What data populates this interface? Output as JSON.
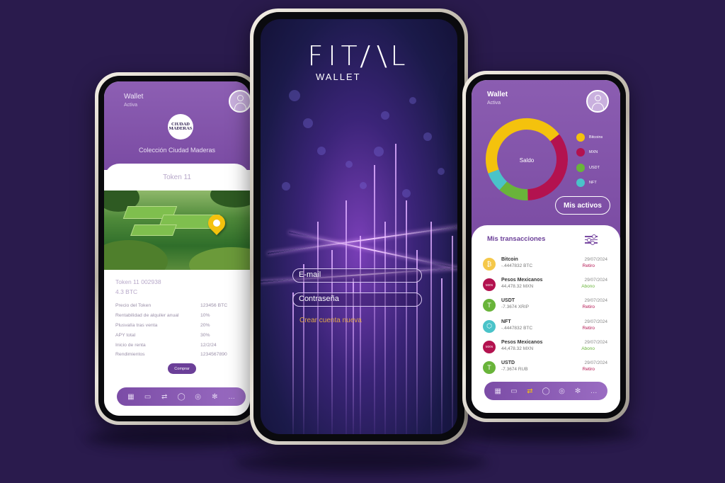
{
  "left_phone": {
    "wallet_label": "Wallet",
    "status": "Activa",
    "logo_lines": [
      "CIUDAD",
      "MADERAS"
    ],
    "collection": "Colección Ciudad Maderas",
    "token_title": "Token 11",
    "token_id": "Token 11 002938",
    "token_price": "4.3 BTC",
    "details": [
      {
        "label": "Precio del Token",
        "value": "123456 BTC"
      },
      {
        "label": "Rentabilidad de alquiler anual",
        "value": "10%"
      },
      {
        "label": "Plusvalía tras venta",
        "value": "20%"
      },
      {
        "label": "APY total",
        "value": "30%"
      },
      {
        "label": "Inicio de renta",
        "value": "12/2/24"
      },
      {
        "label": "Rendimientos",
        "value": "1234567890"
      }
    ],
    "buy_label": "Comprar"
  },
  "center_phone": {
    "brand": "FIT∕\\L",
    "subtitle": "WALLET",
    "email_placeholder": "E-mail",
    "password_placeholder": "Contraseña",
    "create_account": "Crear cuenta nueva"
  },
  "right_phone": {
    "wallet_label": "Wallet",
    "status": "Activa",
    "donut_center": "Saldo",
    "legend": [
      {
        "name": "Bitcoins",
        "color": "#f4c20d"
      },
      {
        "name": "MXN",
        "color": "#b3124f"
      },
      {
        "name": "USDT",
        "color": "#69b43a"
      },
      {
        "name": "NFT",
        "color": "#4ac3c9"
      }
    ],
    "assets_button": "Mis activos",
    "transactions_title": "Mis transacciones",
    "transactions": [
      {
        "name": "Bitcoin",
        "amount": "-.4447832 BTC",
        "date": "29/07/2024",
        "type": "Retiro",
        "icon": "bitcoin-icon",
        "color": "#f5c84a",
        "glyph": "₿"
      },
      {
        "name": "Pesos Mexicanos",
        "amount": "44,478.32 MXN",
        "date": "29/07/2024",
        "type": "Abono",
        "icon": "mxn-icon",
        "color": "#b3124f",
        "glyph": "MXN"
      },
      {
        "name": "USDT",
        "amount": "-7.3674 XRIP",
        "date": "29/07/2024",
        "type": "Retiro",
        "icon": "usdt-icon",
        "color": "#69b43a",
        "glyph": "T"
      },
      {
        "name": "NFT",
        "amount": "-.4447832 BTC",
        "date": "29/07/2024",
        "type": "Retiro",
        "icon": "nft-icon",
        "color": "#4ac3c9",
        "glyph": "⬡"
      },
      {
        "name": "Pesos Mexicanos",
        "amount": "44,478.32 MXN",
        "date": "29/07/2024",
        "type": "Abono",
        "icon": "mxn-icon",
        "color": "#b3124f",
        "glyph": "MXN"
      },
      {
        "name": "USTD",
        "amount": "-7.3674 RUB",
        "date": "29/07/2024",
        "type": "Retiro",
        "icon": "usdt-icon",
        "color": "#69b43a",
        "glyph": "T"
      }
    ],
    "donut_segments": [
      {
        "name": "Bitcoins",
        "value": 45,
        "color": "#f4c20d"
      },
      {
        "name": "MXN",
        "value": 35,
        "color": "#b3124f"
      },
      {
        "name": "USDT",
        "value": 12,
        "color": "#69b43a"
      },
      {
        "name": "NFT",
        "value": 8,
        "color": "#4ac3c9"
      }
    ]
  },
  "nav_icons": [
    "grid-icon",
    "wallet-icon",
    "transfer-icon",
    "profile-icon",
    "coin-icon",
    "settings-icon",
    "chat-icon"
  ],
  "colors": {
    "retiro": "#b3124f",
    "abono": "#69b43a",
    "accent": "#7b4ca3"
  }
}
